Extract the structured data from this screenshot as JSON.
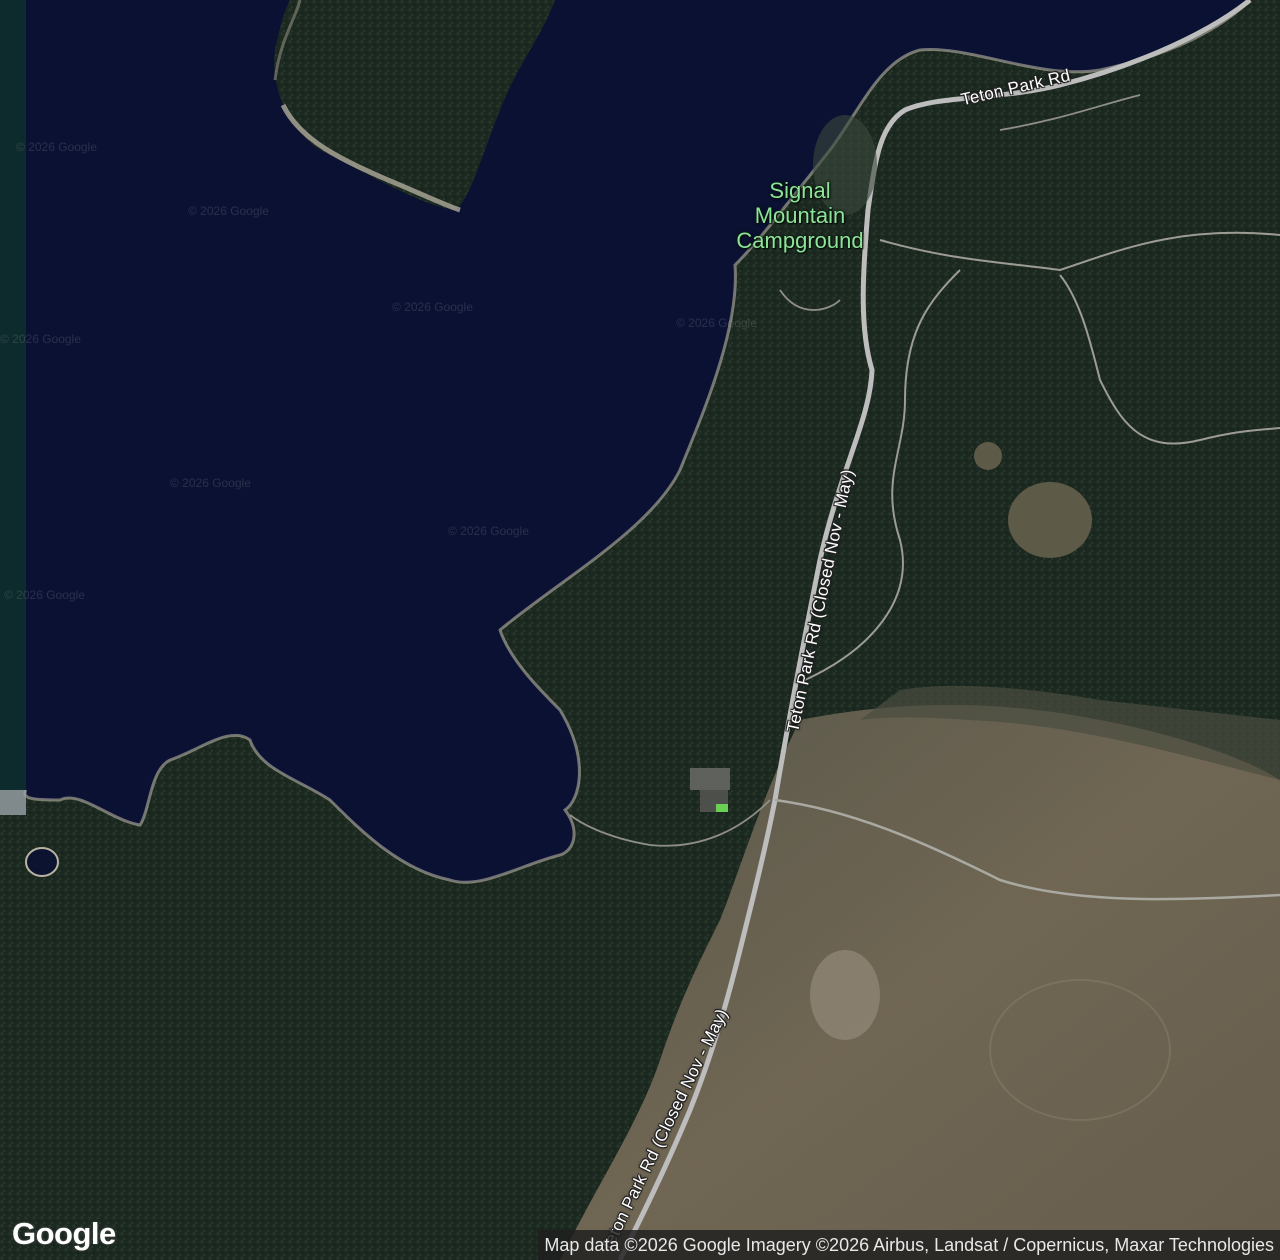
{
  "map": {
    "imagery": "satellite",
    "colors": {
      "lake": "#0a1132",
      "forest": "#1e2b22",
      "grassland": "#6e6455",
      "road": "#bdbdbd",
      "poi_label": "#8ee39a"
    }
  },
  "roads": [
    {
      "label": "Teton Park Rd"
    },
    {
      "label": "Teton Park Rd (Closed Nov - May)"
    },
    {
      "label": "Teton Park Rd (Closed Nov - May)"
    }
  ],
  "poi": {
    "campground": {
      "lines": [
        "Signal",
        "Mountain",
        "Campground"
      ],
      "icon": "campground-icon"
    }
  },
  "watermarks": [
    "© 2026 Google",
    "© 2026 Google",
    "© 2026 Google",
    "© 2026 Google",
    "© 2026 Google",
    "© 2026 Google",
    "© 2026 Google",
    "© 2026 Google"
  ],
  "logo": "Google",
  "attribution": "Map data ©2026 Google Imagery ©2026 Airbus, Landsat / Copernicus, Maxar Technologies"
}
